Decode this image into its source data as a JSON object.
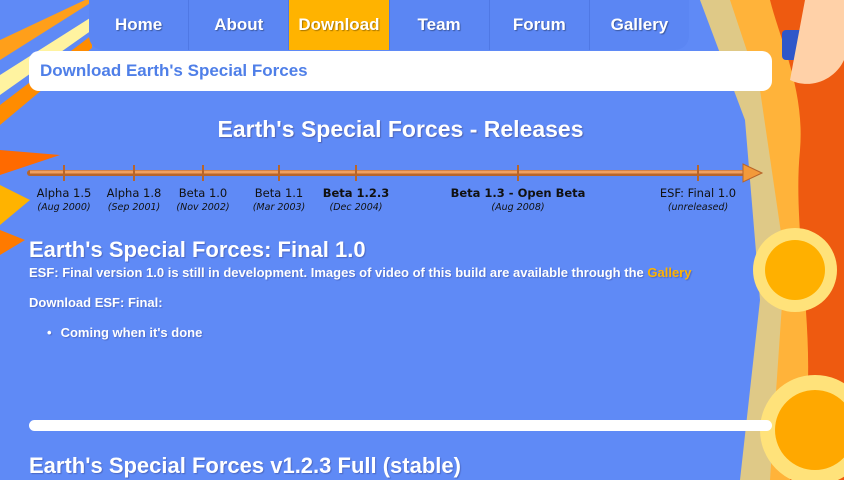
{
  "nav": {
    "items": [
      {
        "label": "Home"
      },
      {
        "label": "About"
      },
      {
        "label": "Download"
      },
      {
        "label": "Team"
      },
      {
        "label": "Forum"
      },
      {
        "label": "Gallery"
      }
    ],
    "active": "Download"
  },
  "header": {
    "title": "Download Earth's Special Forces"
  },
  "releases": {
    "title": "Earth's Special Forces - Releases",
    "items": [
      {
        "name": "Alpha 1.5",
        "date": "(Aug 2000)",
        "bold": false
      },
      {
        "name": "Alpha 1.8",
        "date": "(Sep 2001)",
        "bold": false
      },
      {
        "name": "Beta 1.0",
        "date": "(Nov 2002)",
        "bold": false
      },
      {
        "name": "Beta 1.1",
        "date": "(Mar 2003)",
        "bold": false
      },
      {
        "name": "Beta 1.2.3",
        "date": "(Dec 2004)",
        "bold": true
      },
      {
        "name": "Beta 1.3 - Open Beta",
        "date": "(Aug 2008)",
        "bold": true
      },
      {
        "name": "ESF: Final 1.0",
        "date": "(unreleased)",
        "bold": false
      }
    ]
  },
  "final_section": {
    "title": "Earth's Special Forces: Final 1.0",
    "description": "ESF: Final version 1.0 is still in development. Images of video of this build are available through the",
    "gallery_link": "Gallery",
    "download_label": "Download ESF: Final:",
    "items": [
      "Coming when it's done"
    ]
  },
  "stable_section": {
    "title": "Earth's Special Forces v1.2.3 Full (stable)"
  },
  "colors": {
    "background": "#5f8af6",
    "accent": "#ffb300",
    "header_text": "#4f7fe8",
    "timeline": "#e8873a"
  }
}
